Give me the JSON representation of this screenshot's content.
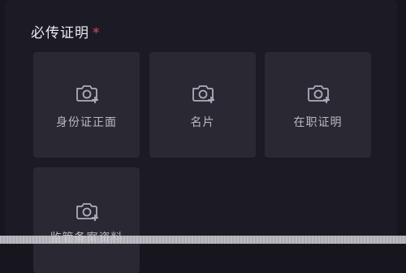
{
  "section": {
    "title": "必传证明",
    "required_mark": "*"
  },
  "upload_tiles": [
    {
      "label": "身份证正面",
      "icon": "camera-plus-icon"
    },
    {
      "label": "名片",
      "icon": "camera-plus-icon"
    },
    {
      "label": "在职证明",
      "icon": "camera-plus-icon"
    },
    {
      "label": "监管备案资料",
      "icon": "camera-plus-icon"
    }
  ],
  "colors": {
    "background": "#17161f",
    "tile": "#2a2933",
    "required": "#e0455e",
    "text": "#eceaf2"
  }
}
